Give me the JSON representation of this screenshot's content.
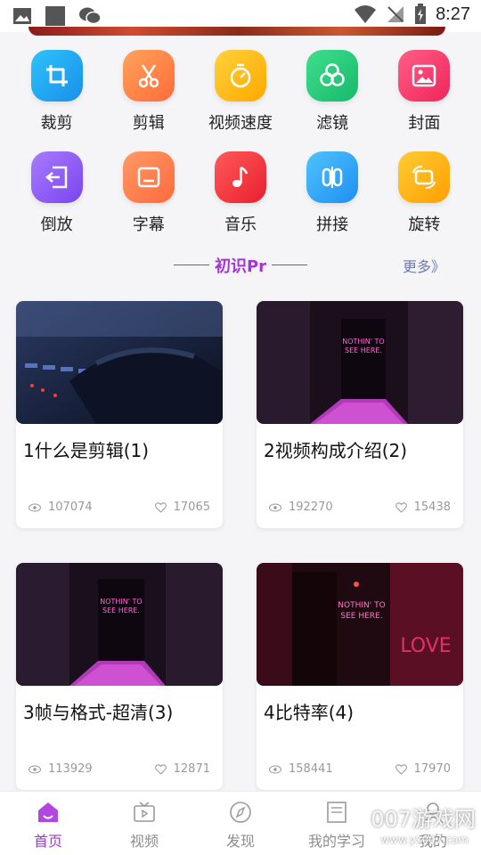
{
  "status_bar": {
    "time": "8:27"
  },
  "tools": [
    {
      "label": "裁剪",
      "icon": "crop-icon",
      "color": "#1aa7f0"
    },
    {
      "label": "剪辑",
      "icon": "scissors-icon",
      "color": "#ff7a3d"
    },
    {
      "label": "视频速度",
      "icon": "stopwatch-icon",
      "color": "#ffb300"
    },
    {
      "label": "滤镜",
      "icon": "filter-icon",
      "color": "#22c77a"
    },
    {
      "label": "封面",
      "icon": "image-icon",
      "color": "#ff3f6e"
    },
    {
      "label": "倒放",
      "icon": "reverse-icon",
      "color": "#8f5bf5"
    },
    {
      "label": "字幕",
      "icon": "subtitle-icon",
      "color": "#ff7446"
    },
    {
      "label": "音乐",
      "icon": "music-icon",
      "color": "#ff3b3b"
    },
    {
      "label": "拼接",
      "icon": "splice-icon",
      "color": "#2aa6f5"
    },
    {
      "label": "旋转",
      "icon": "rotate-icon",
      "color": "#ffb000"
    }
  ],
  "section": {
    "title": "初识Pr",
    "more": "更多》"
  },
  "videos": [
    {
      "title": "1什么是剪辑(1)",
      "views": "107074",
      "likes": "17065"
    },
    {
      "title": "2视频构成介绍(2)",
      "views": "192270",
      "likes": "15438"
    },
    {
      "title": "3帧与格式-超清(3)",
      "views": "113929",
      "likes": "12871"
    },
    {
      "title": "4比特率(4)",
      "views": "158441",
      "likes": "17970"
    }
  ],
  "tabbar": [
    {
      "label": "首页",
      "icon": "home-icon",
      "active": true
    },
    {
      "label": "视频",
      "icon": "tv-icon",
      "active": false
    },
    {
      "label": "发现",
      "icon": "compass-icon",
      "active": false
    },
    {
      "label": "我的学习",
      "icon": "book-icon",
      "active": false
    },
    {
      "label": "我的",
      "icon": "profile-icon",
      "active": false
    }
  ],
  "watermark": {
    "text": "007游戏网",
    "url": "www.yx007.com"
  },
  "colors": {
    "accent": "#a335d6",
    "more_link": "#6a7bb0"
  }
}
